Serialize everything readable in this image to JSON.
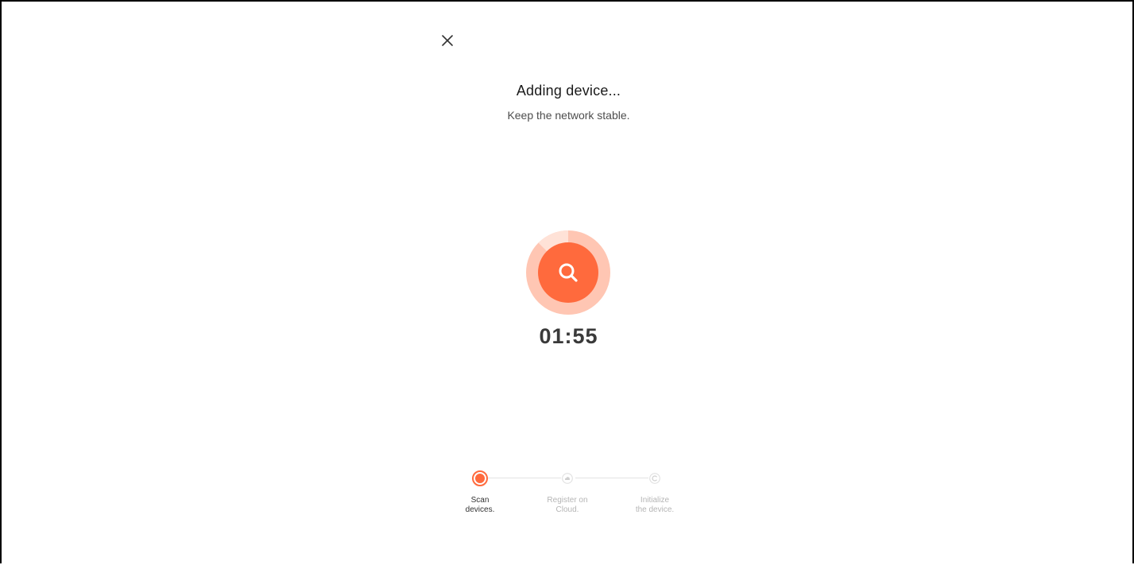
{
  "header": {
    "close_icon": "close-icon",
    "title": "Adding device...",
    "subtitle": "Keep the network stable."
  },
  "scan": {
    "icon": "search-icon",
    "timer": "01:55",
    "accent_color": "#ff6a3d",
    "ring_color": "#ffc2ad"
  },
  "steps": [
    {
      "label": "Scan\ndevices.",
      "state": "active",
      "icon": "scan-dot-icon"
    },
    {
      "label": "Register on\nCloud.",
      "state": "inactive",
      "icon": "cloud-icon"
    },
    {
      "label": "Initialize\nthe device.",
      "state": "inactive",
      "icon": "initialize-icon"
    }
  ]
}
